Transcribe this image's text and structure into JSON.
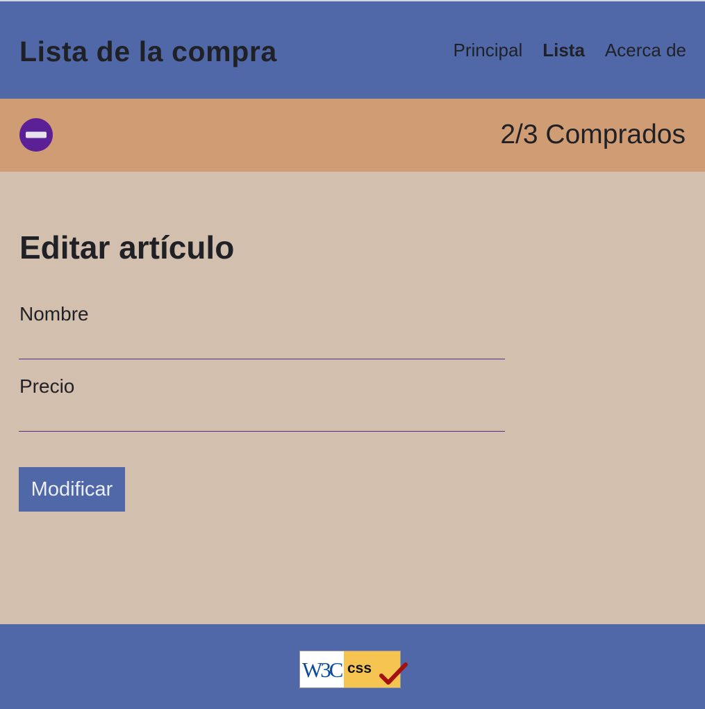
{
  "header": {
    "title": "Lista de la compra",
    "nav": [
      "Principal",
      "Lista",
      "Acerca de"
    ],
    "active_nav": "Lista"
  },
  "status": {
    "icon": "minus-circle-icon",
    "text": "2/3 Comprados"
  },
  "form": {
    "title": "Editar artículo",
    "fields": [
      {
        "label": "Nombre",
        "value": ""
      },
      {
        "label": "Precio",
        "value": ""
      }
    ],
    "submit_label": "Modificar"
  },
  "footer": {
    "badge": "W3C CSS validation badge",
    "badge_text": [
      "W3C",
      "css"
    ]
  },
  "colors": {
    "header_bg": "#5168a8",
    "status_bg": "#d09c73",
    "content_bg": "#d3bfae",
    "icon": "#5b1f96",
    "button_bg": "#5168a8",
    "button_text": "#eaeef7"
  }
}
